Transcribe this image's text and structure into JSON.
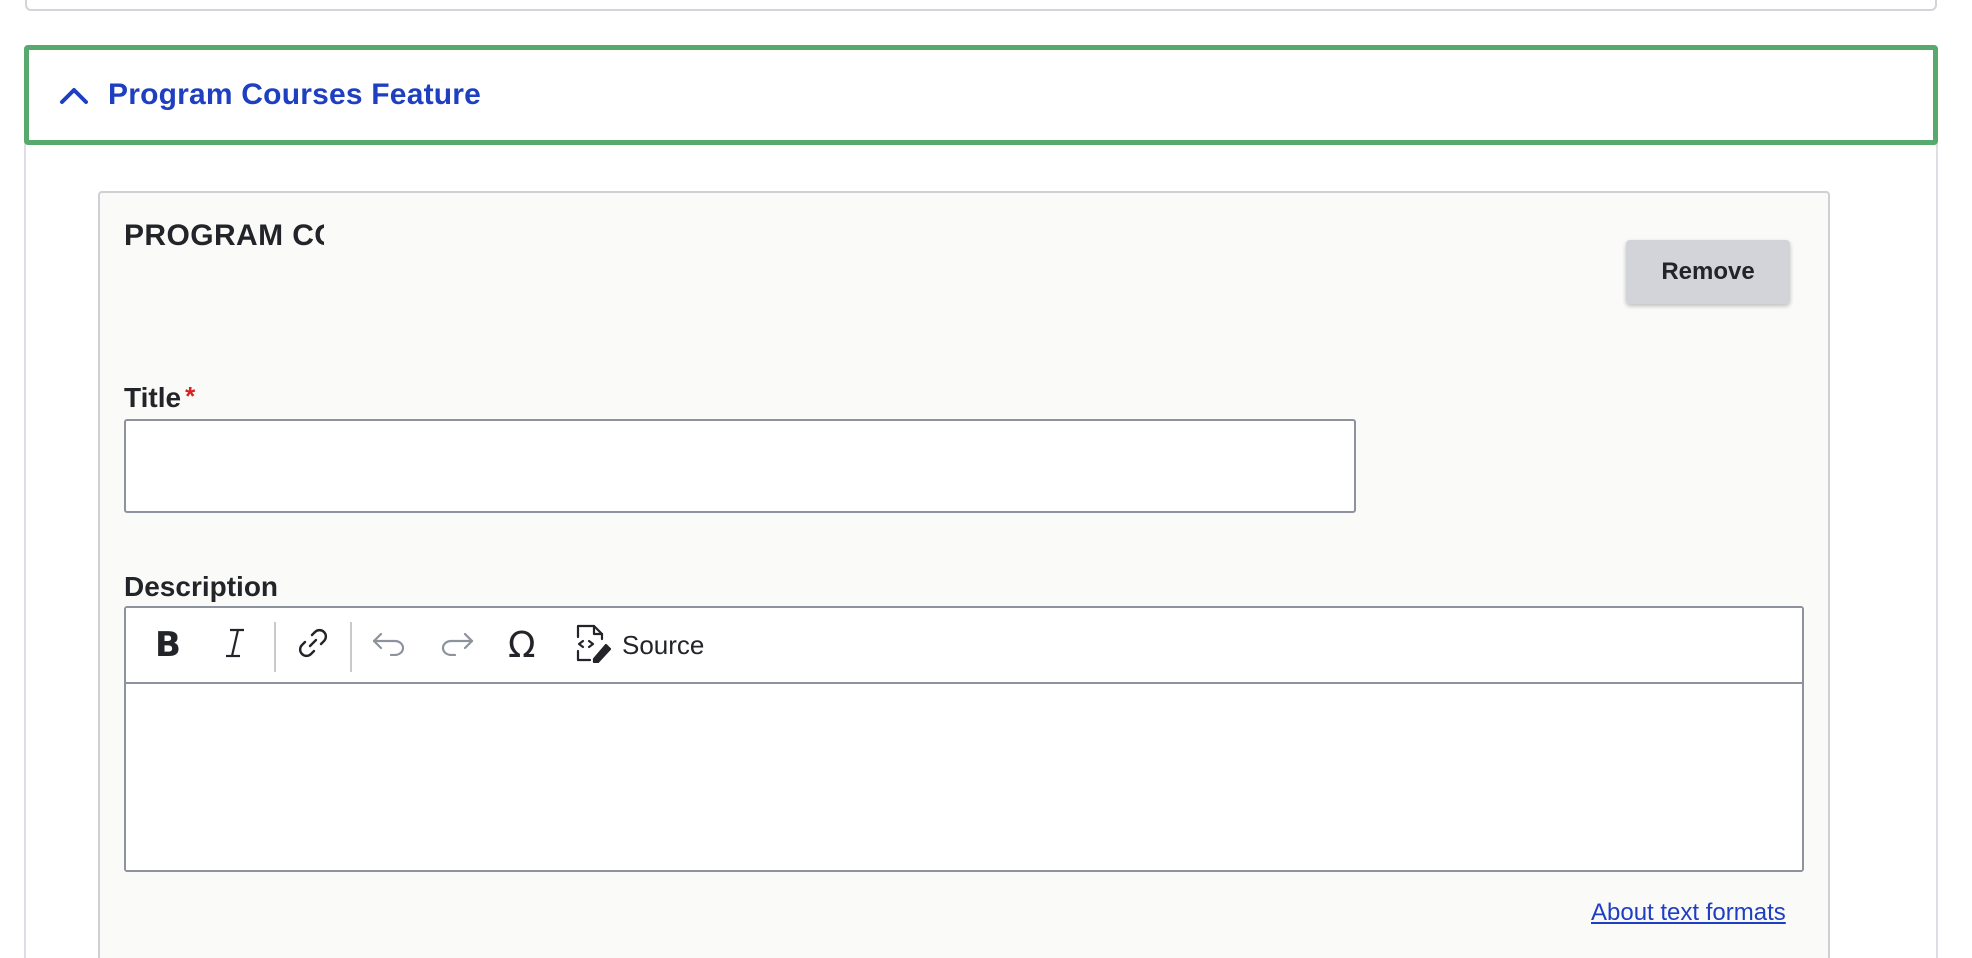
{
  "section": {
    "title": "Program Courses Feature",
    "expanded": true,
    "accent_color": "#57a96e",
    "title_color": "#1e3fc2",
    "toggle_icon": "chevron-up-icon"
  },
  "paragraph": {
    "type_label": "PROGRAM CO",
    "remove_label": "Remove"
  },
  "fields": {
    "title": {
      "label": "Title",
      "required_marker": "*",
      "value": ""
    },
    "description": {
      "label": "Description",
      "value": ""
    }
  },
  "toolbar": {
    "items": [
      {
        "name": "bold",
        "icon": "bold-icon"
      },
      {
        "name": "italic",
        "icon": "italic-icon"
      },
      {
        "name": "link",
        "icon": "link-icon"
      },
      {
        "name": "undo",
        "icon": "undo-icon"
      },
      {
        "name": "redo",
        "icon": "redo-icon"
      },
      {
        "name": "special-characters",
        "icon": "omega-icon"
      },
      {
        "name": "source",
        "icon": "source-edit-icon"
      }
    ],
    "source_label": "Source"
  },
  "help": {
    "text_formats_link": "About text formats"
  }
}
